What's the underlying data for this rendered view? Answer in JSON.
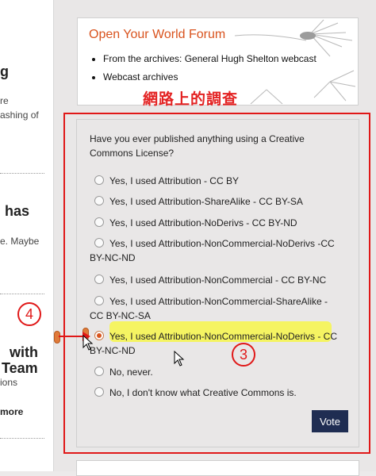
{
  "left": {
    "g_fragment": "g",
    "re_fragment": "re",
    "ashing_fragment": "ashing of",
    "has_fragment": "has",
    "maybe_fragment": "e. Maybe",
    "with_fragment": "with",
    "team_fragment": "Team",
    "ions_fragment": "ions",
    "more_fragment": "more"
  },
  "forum": {
    "title": "Open Your World Forum",
    "links": [
      "From the archives: General Hugh Shelton webcast",
      "Webcast archives"
    ],
    "caption": "網路上的調查"
  },
  "poll": {
    "question": "Have you ever published anything using a Creative Commons License?",
    "options": [
      {
        "label": "Yes, I used Attribution - CC BY",
        "checked": false
      },
      {
        "label": "Yes, I used Attribution-ShareAlike - CC BY-SA",
        "checked": false
      },
      {
        "label": "Yes, I used Attribution-NoDerivs - CC BY-ND",
        "checked": false
      },
      {
        "label": "Yes, I used Attribution-NonCommercial-NoDerivs -CC BY-NC-ND",
        "checked": false
      },
      {
        "label": "Yes, I used Attribution-NonCommercial - CC BY-NC",
        "checked": false
      },
      {
        "label": "Yes, I used Attribution-NonCommercial-ShareAlike - CC BY-NC-SA",
        "checked": false
      },
      {
        "label": "Yes, I used Attribution-NonCommercial-NoDerivs - CC BY-NC-ND",
        "checked": true
      },
      {
        "label": "No, never.",
        "checked": false
      },
      {
        "label": "No, I don't know what Creative Commons is.",
        "checked": false
      }
    ],
    "vote_label": "Vote"
  },
  "annotations": {
    "step_four": "4",
    "step_three": "3"
  },
  "colors": {
    "accent_orange": "#d9531e",
    "annotation_red": "#e01818",
    "vote_bg": "#1f2d52",
    "highlight_yellow": "#f7f64a"
  }
}
